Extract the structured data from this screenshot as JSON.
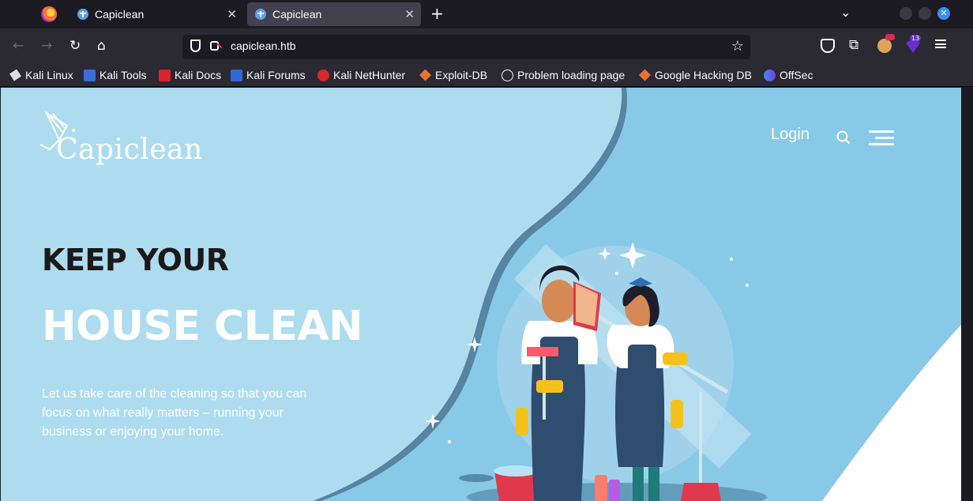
{
  "browser": {
    "tabs": [
      {
        "label": "Capiclean",
        "active": false
      },
      {
        "label": "Capiclean",
        "active": true
      }
    ],
    "url": "capiclean.htb",
    "extension_badge": "13",
    "bookmarks": [
      {
        "label": "Kali Linux",
        "icon": "kali-dragon-icon"
      },
      {
        "label": "Kali Tools",
        "icon": "kali-tools-icon"
      },
      {
        "label": "Kali Docs",
        "icon": "kali-docs-icon"
      },
      {
        "label": "Kali Forums",
        "icon": "kali-forums-icon"
      },
      {
        "label": "Kali NetHunter",
        "icon": "nethunter-icon"
      },
      {
        "label": "Exploit-DB",
        "icon": "exploit-db-icon"
      },
      {
        "label": "Problem loading page",
        "icon": "globe-icon"
      },
      {
        "label": "Google Hacking DB",
        "icon": "ghdb-icon"
      },
      {
        "label": "OffSec",
        "icon": "offsec-icon"
      }
    ]
  },
  "site": {
    "logo_text": "Capiclean",
    "nav": {
      "login": "Login"
    },
    "hero": {
      "line1": "KEEP YOUR",
      "line2": "HOUSE CLEAN",
      "description": "Let us take care of the cleaning so that you can focus on what really matters – running your business or enjoying your home."
    },
    "colors": {
      "background_light": "#aedcef",
      "background_dark": "#89c9e8",
      "heading_dark": "#1a1a1a",
      "white": "#ffffff"
    }
  }
}
